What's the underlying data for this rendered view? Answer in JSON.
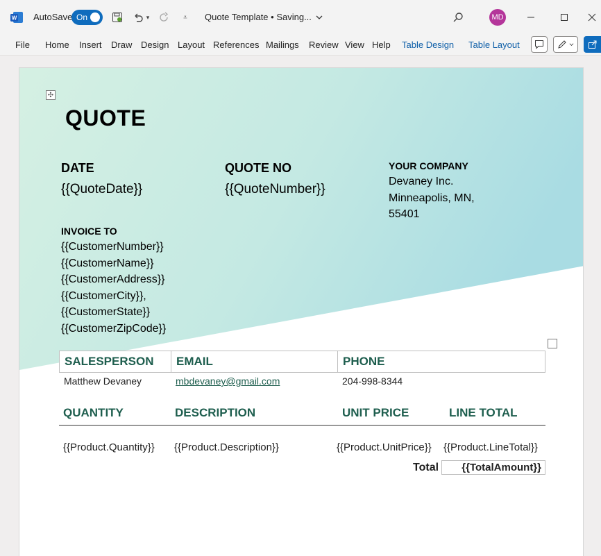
{
  "titlebar": {
    "app_icon": "word-logo-icon",
    "autosave_label": "AutoSave",
    "autosave_state": "On",
    "document_title": "Quote Template • Saving...",
    "avatar_initials": "MD",
    "avatar_color": "#b4359a",
    "accent_color": "#0f6cbd"
  },
  "ribbon": {
    "tabs": [
      "File",
      "Home",
      "Insert",
      "Draw",
      "Design",
      "Layout",
      "References",
      "Mailings",
      "Review",
      "View",
      "Help",
      "Table Design",
      "Table Layout"
    ]
  },
  "document": {
    "title": "QUOTE",
    "date_label": "DATE",
    "date_value": "{{QuoteDate}}",
    "quote_no_label": "QUOTE NO",
    "quote_no_value": "{{QuoteNumber}}",
    "company_label": "YOUR COMPANY",
    "company_lines": [
      "Devaney Inc.",
      "Minneapolis, MN,",
      "55401"
    ],
    "invoice_to_label": "INVOICE TO",
    "invoice_lines": [
      "{{CustomerNumber}}",
      "{{CustomerName}}",
      "{{CustomerAddress}}",
      "{{CustomerCity}},",
      "{{CustomerState}}",
      "{{CustomerZipCode}}"
    ],
    "sales_table": {
      "headers": [
        "SALESPERSON",
        "EMAIL",
        "PHONE"
      ],
      "row": {
        "salesperson": "Matthew Devaney",
        "email": "mbdevaney@gmail.com",
        "phone": "204-998-8344"
      }
    },
    "line_items": {
      "headers": [
        "QUANTITY",
        "DESCRIPTION",
        "UNIT PRICE",
        "LINE TOTAL"
      ],
      "row": [
        "{{Product.Quantity}}",
        "{{Product.Description}}",
        "{{Product.UnitPrice}}",
        "{{Product.LineTotal}}"
      ],
      "total_label": "Total",
      "total_value": "{{TotalAmount}}"
    },
    "heading_color": "#1e5e4e"
  }
}
